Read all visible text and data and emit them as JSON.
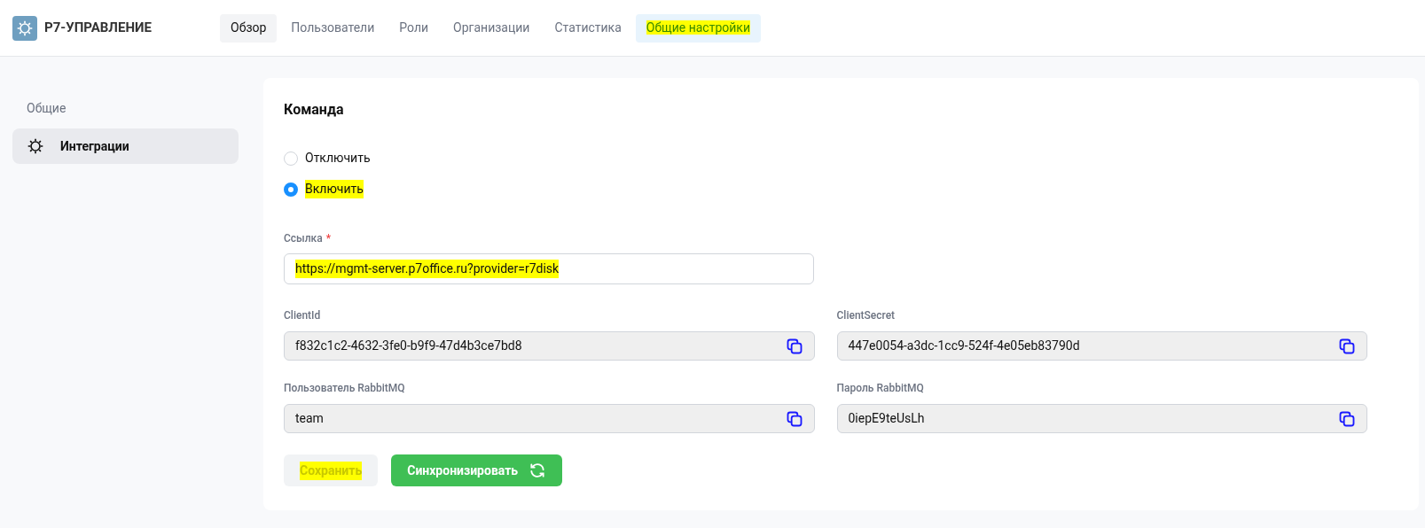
{
  "brand": {
    "name": "Р7-УПРАВЛЕНИЕ"
  },
  "tabs": [
    {
      "label": "Обзор",
      "selected": true,
      "highlighted": false
    },
    {
      "label": "Пользователи",
      "selected": false,
      "highlighted": false
    },
    {
      "label": "Роли",
      "selected": false,
      "highlighted": false
    },
    {
      "label": "Организации",
      "selected": false,
      "highlighted": false
    },
    {
      "label": "Статистика",
      "selected": false,
      "highlighted": false
    },
    {
      "label": "Общие настройки",
      "selected": false,
      "highlighted": true
    }
  ],
  "sidebar": {
    "heading": "Общие",
    "items": [
      {
        "label": "Интеграции",
        "selected": true
      }
    ]
  },
  "section": {
    "title": "Команда",
    "options": [
      {
        "label": "Отключить",
        "selected": false,
        "highlighted": false
      },
      {
        "label": "Включить",
        "selected": true,
        "highlighted": true
      }
    ],
    "link": {
      "label": "Ссылка",
      "required_mark": "*",
      "value": "https://mgmt-server.p7office.ru?provider=r7disk",
      "highlighted": true
    },
    "fields": [
      {
        "label": "ClientId",
        "value": "f832c1c2-4632-3fe0-b9f9-47d4b3ce7bd8"
      },
      {
        "label": "ClientSecret",
        "value": "447e0054-a3dc-1cc9-524f-4e05eb83790d"
      },
      {
        "label": "Пользователь RabbitMQ",
        "value": "team"
      },
      {
        "label": "Пароль RabbitMQ",
        "value": "0iepE9teUsLh"
      }
    ],
    "buttons": [
      {
        "kind": "secondary",
        "label": "Сохранить",
        "highlighted": true
      },
      {
        "kind": "primary",
        "label": "Синхронизировать",
        "highlighted": false
      }
    ]
  }
}
